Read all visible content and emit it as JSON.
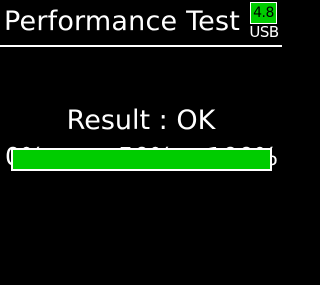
{
  "header": {
    "title": "Performance Test",
    "usb_badge": {
      "voltage": "4.8",
      "label": "USB"
    }
  },
  "result": {
    "text": "Result : OK"
  },
  "progress": {
    "scale_labels": [
      "0%",
      "50%",
      "100%"
    ],
    "value_percent": 100,
    "fill_color": "#00cc00"
  }
}
